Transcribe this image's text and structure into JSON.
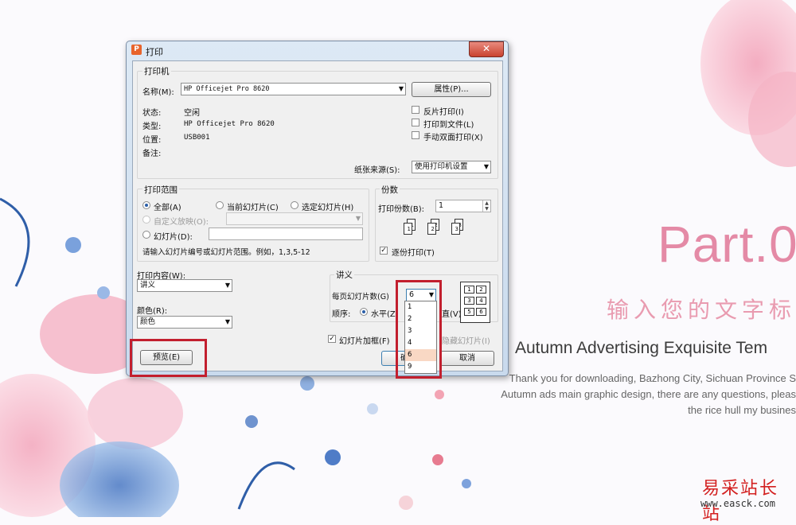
{
  "slide": {
    "part_title": "Part.0",
    "subtitle_cn": "输入您的文字标",
    "eng_title": "Autumn Advertising Exquisite Tem",
    "eng_body": [
      "Thank you for downloading, Bazhong City, Sichuan Province S",
      "Autumn ads main graphic design, there are any questions, pleas",
      "the rice hull my busines"
    ]
  },
  "watermark": {
    "cn": "易采站长站",
    "url": "www.easck.com"
  },
  "dialog": {
    "title": "打印",
    "close_glyph": "✕",
    "printer": {
      "group_title": "打印机",
      "name_label": "名称(M):",
      "name_value": "HP Officejet Pro 8620",
      "properties_button": "属性(P)...",
      "status_label": "状态:",
      "status_value": "空闲",
      "type_label": "类型:",
      "type_value": "HP Officejet Pro 8620",
      "location_label": "位置:",
      "location_value": "USB001",
      "comment_label": "备注:",
      "reverse_print": "反片打印(I)",
      "print_to_file": "打印到文件(L)",
      "manual_duplex": "手动双面打印(X)",
      "paper_source_label": "纸张来源(S):",
      "paper_source_value": "使用打印机设置"
    },
    "range": {
      "group_title": "打印范围",
      "all": "全部(A)",
      "current_slide": "当前幻灯片(C)",
      "selected_slides": "选定幻灯片(H)",
      "custom_show": "自定义放映(O):",
      "slides": "幻灯片(D):",
      "hint": "请输入幻灯片编号或幻灯片范围。例如，1,3,5-12"
    },
    "copies": {
      "group_title": "份数",
      "count_label": "打印份数(B):",
      "count_value": "1",
      "collate": "逐份打印(T)",
      "copy_icon_labels": [
        "1",
        "1",
        "2",
        "2",
        "3",
        "3"
      ]
    },
    "content": {
      "label": "打印内容(W):",
      "value": "讲义",
      "color_label": "颜色(R):",
      "color_value": "颜色"
    },
    "handout": {
      "group_title": "讲义",
      "per_page_label": "每页幻灯片数(G)",
      "per_page_value": "6",
      "per_page_options": [
        "1",
        "2",
        "3",
        "4",
        "6",
        "9"
      ],
      "order_label": "顺序:",
      "horizontal": "水平(Z)",
      "vertical_partial": "直(V)",
      "layout_cells": [
        "1",
        "2",
        "3",
        "4",
        "5",
        "6"
      ]
    },
    "frame_slides": "幻灯片加框(F)",
    "hidden_slides": "隐藏幻灯片(I)",
    "preview_button": "预览(E)",
    "ok_button": "确定",
    "cancel_button": "取消"
  },
  "colors": {
    "highlight": "#c21f2e",
    "accent_pink": "#e48aa6"
  }
}
